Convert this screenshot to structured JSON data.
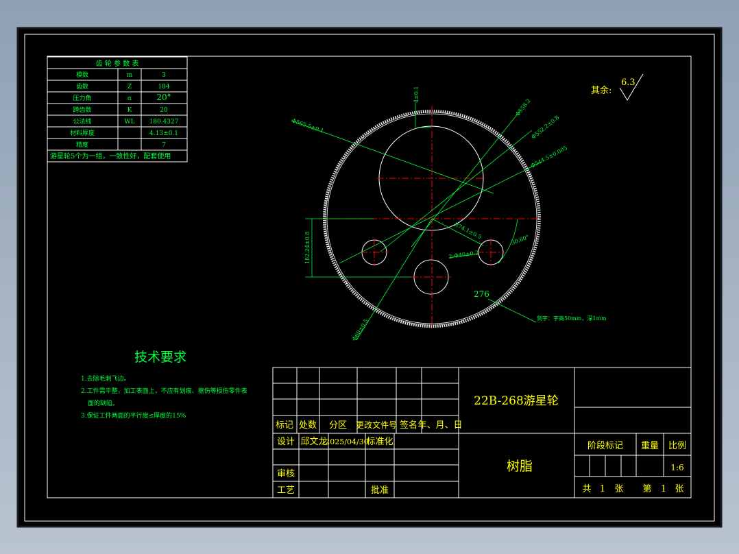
{
  "params_table": {
    "title": "齿 轮 参 数 表",
    "rows": [
      {
        "name": "模数",
        "symbol": "m",
        "value": "3"
      },
      {
        "name": "齿数",
        "symbol": "Z",
        "value": "184"
      },
      {
        "name": "压力角",
        "symbol": "α",
        "value": "20°"
      },
      {
        "name": "跨齿数",
        "symbol": "K",
        "value": "20"
      },
      {
        "name": "公法线",
        "symbol": "WL",
        "value": "180.4327"
      },
      {
        "name": "材料厚度",
        "symbol": "",
        "value": "4.13±0.1"
      },
      {
        "name": "精度",
        "symbol": "",
        "value": "7"
      }
    ],
    "note": "游星轮5个为一组，一致性好，配套使用"
  },
  "roughness": {
    "label": "其余:",
    "value": "6.3"
  },
  "dimensions": {
    "top_small": "4±0.1",
    "upper_left": "Φ565.5±0.1",
    "r1": "Φ558.2",
    "r2": "Φ552.2±0.8",
    "r3": "Φ544.5±0.005",
    "center": "R74.1±0.5",
    "left_vertical": "182.24±0.8",
    "angle": "30.60°",
    "holes": "2-Φ40±0.2",
    "bottom_left": "Φ60±0.5",
    "label_276": "276",
    "note_276": "刻字：字高50mm，深1mm"
  },
  "tech": {
    "title": "技术要求",
    "items": [
      "1.去除毛刺飞边。",
      "2.工件需平整，加工表面上，不应有划痕、擦伤等损伤零件表",
      "面的缺陷。",
      "3.保证工件两面的平行度≤厚度的15%"
    ]
  },
  "title_block": {
    "headers": [
      "标记",
      "处数",
      "分区",
      "更改文件号",
      "签名",
      "年、月、日"
    ],
    "design_label": "设计",
    "designer": "邱文龙",
    "date": "2025/04/30",
    "standard": "标准化",
    "review": "审核",
    "process": "工艺",
    "approve": "批准",
    "drawing_name": "22B-268游星轮",
    "material": "树脂",
    "stage_mark": "阶段标记",
    "weight": "重量",
    "scale_label": "比例",
    "scale": "1:6",
    "total": "共",
    "total_count": "1",
    "sheet_unit": "张",
    "sheet": "第",
    "sheet_no": "1",
    "sheet_unit2": "张"
  },
  "colors": {
    "line": "#00ff3a",
    "text": "#ffff00",
    "geometry": "#ffffff",
    "center": "#ff0000",
    "background": "#000000"
  }
}
